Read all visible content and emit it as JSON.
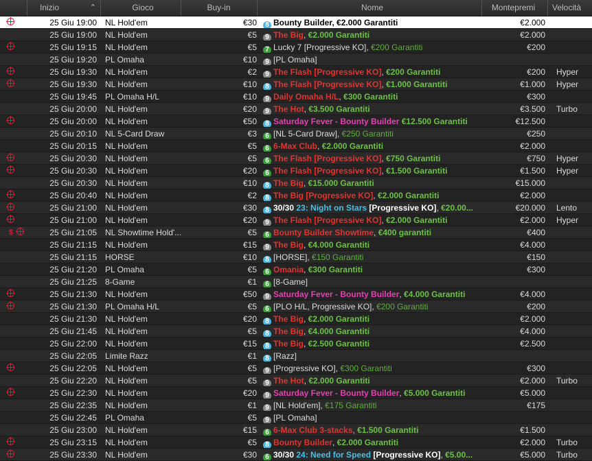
{
  "headers": {
    "start": "Inizio",
    "game": "Gioco",
    "buyin": "Buy-in",
    "name": "Nome",
    "prize": "Montepremi",
    "speed": "Velocità",
    "sort_icon": "sort-up-arrow-icon"
  },
  "colors": {
    "target_icon": "#e01b2f",
    "red_title": "#e2342f",
    "green_guarantee": "#6cc244",
    "pink_title": "#e640b4",
    "cyan_title": "#49c0e6",
    "badge_cyan": "#4fb6e0",
    "badge_gray": "#8a8a8a",
    "badge_green": "#3d9e3d"
  },
  "rows": [
    {
      "icon": "target",
      "start": "25 Giu  19:00",
      "game": "NL Hold'em",
      "buyin": "€30",
      "badge": "8",
      "badge_color": "cyan",
      "parts": [
        {
          "t": "Bounty Builder",
          "c": "white-b"
        },
        {
          "t": ", ",
          "c": "white-b"
        },
        {
          "t": "€2.000 Garantiti",
          "c": "white-b"
        }
      ],
      "prize": "€2.000",
      "speed": "",
      "selected": true
    },
    {
      "icon": "",
      "start": "25 Giu  19:00",
      "game": "NL Hold'em",
      "buyin": "€5",
      "badge": "9",
      "badge_color": "gray",
      "parts": [
        {
          "t": "The Big",
          "c": "red"
        },
        {
          "t": ", ",
          "c": "plain"
        },
        {
          "t": "€2.000 Garantiti",
          "c": "green"
        }
      ],
      "prize": "€2.000",
      "speed": ""
    },
    {
      "icon": "target",
      "start": "25 Giu  19:15",
      "game": "NL Hold'em",
      "buyin": "€5",
      "badge": "7",
      "badge_color": "green",
      "parts": [
        {
          "t": "Lucky 7 [Progressive KO]",
          "c": "plain"
        },
        {
          "t": ", ",
          "c": "plain"
        },
        {
          "t": "€200 Garantiti",
          "c": "dkgreen"
        }
      ],
      "prize": "€200",
      "speed": ""
    },
    {
      "icon": "",
      "start": "25 Giu  19:20",
      "game": "PL Omaha",
      "buyin": "€10",
      "badge": "9",
      "badge_color": "gray",
      "parts": [
        {
          "t": "[PL Omaha]",
          "c": "plain"
        }
      ],
      "prize": "",
      "speed": ""
    },
    {
      "icon": "target",
      "start": "25 Giu  19:30",
      "game": "NL Hold'em",
      "buyin": "€2",
      "badge": "9",
      "badge_color": "gray",
      "parts": [
        {
          "t": "The Flash [Progressive KO]",
          "c": "red"
        },
        {
          "t": ", ",
          "c": "plain"
        },
        {
          "t": "€200 Garantiti",
          "c": "green"
        }
      ],
      "prize": "€200",
      "speed": "Hyper"
    },
    {
      "icon": "target",
      "start": "25 Giu  19:30",
      "game": "NL Hold'em",
      "buyin": "€10",
      "badge": "8",
      "badge_color": "cyan",
      "parts": [
        {
          "t": "The Flash [Progressive KO]",
          "c": "red"
        },
        {
          "t": ", ",
          "c": "plain"
        },
        {
          "t": "€1.000 Garantiti",
          "c": "green"
        }
      ],
      "prize": "€1.000",
      "speed": "Hyper"
    },
    {
      "icon": "",
      "start": "25 Giu  19:45",
      "game": "PL Omaha H/L",
      "buyin": "€10",
      "badge": "9",
      "badge_color": "gray",
      "parts": [
        {
          "t": "Daily Omaha H/L",
          "c": "red"
        },
        {
          "t": ", ",
          "c": "plain"
        },
        {
          "t": "€300 Garantiti",
          "c": "green"
        }
      ],
      "prize": "€300",
      "speed": ""
    },
    {
      "icon": "",
      "start": "25 Giu  20:00",
      "game": "NL Hold'em",
      "buyin": "€20",
      "badge": "9",
      "badge_color": "gray",
      "parts": [
        {
          "t": "The Hot",
          "c": "red"
        },
        {
          "t": ", ",
          "c": "plain"
        },
        {
          "t": "€3.500 Garantiti",
          "c": "green"
        }
      ],
      "prize": "€3.500",
      "speed": "Turbo"
    },
    {
      "icon": "target",
      "start": "25 Giu  20:00",
      "game": "NL Hold'em",
      "buyin": "€50",
      "badge": "8",
      "badge_color": "cyan",
      "parts": [
        {
          "t": "Saturday Fever - Bounty Builder",
          "c": "pink"
        },
        {
          "t": " ",
          "c": "plain"
        },
        {
          "t": "€12.500 Garantiti",
          "c": "green"
        }
      ],
      "prize": "€12.500",
      "speed": ""
    },
    {
      "icon": "",
      "start": "25 Giu  20:10",
      "game": "NL 5-Card Draw",
      "buyin": "€3",
      "badge": "6",
      "badge_color": "green",
      "parts": [
        {
          "t": "[NL 5-Card Draw]",
          "c": "plain"
        },
        {
          "t": ", ",
          "c": "plain"
        },
        {
          "t": "€250 Garantiti",
          "c": "dkgreen"
        }
      ],
      "prize": "€250",
      "speed": ""
    },
    {
      "icon": "",
      "start": "25 Giu  20:15",
      "game": "NL Hold'em",
      "buyin": "€5",
      "badge": "6",
      "badge_color": "green",
      "parts": [
        {
          "t": "6-Max Club",
          "c": "red"
        },
        {
          "t": ", ",
          "c": "plain"
        },
        {
          "t": "€2.000 Garantiti",
          "c": "green"
        }
      ],
      "prize": "€2.000",
      "speed": ""
    },
    {
      "icon": "target",
      "start": "25 Giu  20:30",
      "game": "NL Hold'em",
      "buyin": "€5",
      "badge": "6",
      "badge_color": "green",
      "parts": [
        {
          "t": "The Flash [Progressive KO]",
          "c": "red"
        },
        {
          "t": ", ",
          "c": "plain"
        },
        {
          "t": "€750 Garantiti",
          "c": "green"
        }
      ],
      "prize": "€750",
      "speed": "Hyper"
    },
    {
      "icon": "target",
      "start": "25 Giu  20:30",
      "game": "NL Hold'em",
      "buyin": "€20",
      "badge": "6",
      "badge_color": "green",
      "parts": [
        {
          "t": "The Flash [Progressive KO]",
          "c": "red"
        },
        {
          "t": ", ",
          "c": "plain"
        },
        {
          "t": "€1.500 Garantiti",
          "c": "green"
        }
      ],
      "prize": "€1.500",
      "speed": "Hyper"
    },
    {
      "icon": "",
      "start": "25 Giu  20:30",
      "game": "NL Hold'em",
      "buyin": "€10",
      "badge": "8",
      "badge_color": "cyan",
      "parts": [
        {
          "t": "The Big",
          "c": "red"
        },
        {
          "t": ", ",
          "c": "plain"
        },
        {
          "t": "€15.000 Garantiti",
          "c": "green"
        }
      ],
      "prize": "€15.000",
      "speed": ""
    },
    {
      "icon": "target",
      "start": "25 Giu  20:40",
      "game": "NL Hold'em",
      "buyin": "€2",
      "badge": "8",
      "badge_color": "cyan",
      "parts": [
        {
          "t": "The Big [Progressive KO]",
          "c": "red"
        },
        {
          "t": ", ",
          "c": "plain"
        },
        {
          "t": "€2.000 Garantiti",
          "c": "green"
        }
      ],
      "prize": "€2.000",
      "speed": ""
    },
    {
      "icon": "target",
      "start": "25 Giu  21:00",
      "game": "NL Hold'em",
      "buyin": "€30",
      "badge": "8",
      "badge_color": "cyan",
      "parts": [
        {
          "t": "30/30 ",
          "c": "white-b"
        },
        {
          "t": "23: Night on Stars",
          "c": "cyan"
        },
        {
          "t": " [Progressive KO]",
          "c": "white-b"
        },
        {
          "t": ", ",
          "c": "plain"
        },
        {
          "t": "€20.00...",
          "c": "green"
        }
      ],
      "prize": "€20.000",
      "speed": "Lento"
    },
    {
      "icon": "target",
      "start": "25 Giu  21:00",
      "game": "NL Hold'em",
      "buyin": "€20",
      "badge": "9",
      "badge_color": "gray",
      "parts": [
        {
          "t": "The Flash [Progressive KO]",
          "c": "red"
        },
        {
          "t": ", ",
          "c": "plain"
        },
        {
          "t": "€2.000 Garantiti",
          "c": "green"
        }
      ],
      "prize": "€2.000",
      "speed": "Hyper"
    },
    {
      "icon": "dollar-target",
      "start": "25 Giu  21:05",
      "game": "NL Showtime Hold'...",
      "buyin": "€5",
      "badge": "6",
      "badge_color": "green",
      "parts": [
        {
          "t": "Bounty Builder Showtime",
          "c": "red"
        },
        {
          "t": ", ",
          "c": "plain"
        },
        {
          "t": "€400 garantiti",
          "c": "green"
        }
      ],
      "prize": "€400",
      "speed": ""
    },
    {
      "icon": "",
      "start": "25 Giu  21:15",
      "game": "NL Hold'em",
      "buyin": "€15",
      "badge": "9",
      "badge_color": "gray",
      "parts": [
        {
          "t": "The Big",
          "c": "red"
        },
        {
          "t": ", ",
          "c": "plain"
        },
        {
          "t": "€4.000 Garantiti",
          "c": "green"
        }
      ],
      "prize": "€4.000",
      "speed": ""
    },
    {
      "icon": "",
      "start": "25 Giu  21:15",
      "game": "HORSE",
      "buyin": "€10",
      "badge": "8",
      "badge_color": "cyan",
      "parts": [
        {
          "t": "[HORSE]",
          "c": "plain"
        },
        {
          "t": ", ",
          "c": "plain"
        },
        {
          "t": "€150 Garantiti",
          "c": "dkgreen"
        }
      ],
      "prize": "€150",
      "speed": ""
    },
    {
      "icon": "",
      "start": "25 Giu  21:20",
      "game": "PL Omaha",
      "buyin": "€5",
      "badge": "6",
      "badge_color": "green",
      "parts": [
        {
          "t": "Omania",
          "c": "red"
        },
        {
          "t": ", ",
          "c": "plain"
        },
        {
          "t": "€300 Garantiti",
          "c": "green"
        }
      ],
      "prize": "€300",
      "speed": ""
    },
    {
      "icon": "",
      "start": "25 Giu  21:25",
      "game": "8-Game",
      "buyin": "€1",
      "badge": "6",
      "badge_color": "green",
      "parts": [
        {
          "t": "[8-Game]",
          "c": "plain"
        }
      ],
      "prize": "",
      "speed": ""
    },
    {
      "icon": "target",
      "start": "25 Giu  21:30",
      "game": "NL Hold'em",
      "buyin": "€50",
      "badge": "9",
      "badge_color": "gray",
      "parts": [
        {
          "t": "Saturday Fever - Bounty Builder",
          "c": "pink"
        },
        {
          "t": ", ",
          "c": "plain"
        },
        {
          "t": "€4.000 Garantiti",
          "c": "green"
        }
      ],
      "prize": "€4.000",
      "speed": ""
    },
    {
      "icon": "target",
      "start": "25 Giu  21:30",
      "game": "PL Omaha H/L",
      "buyin": "€5",
      "badge": "6",
      "badge_color": "green",
      "parts": [
        {
          "t": "[PLO H/L, Progressive KO]",
          "c": "plain"
        },
        {
          "t": ", ",
          "c": "plain"
        },
        {
          "t": "€200 Garantiti",
          "c": "dkgreen"
        }
      ],
      "prize": "€200",
      "speed": ""
    },
    {
      "icon": "",
      "start": "25 Giu  21:30",
      "game": "NL Hold'em",
      "buyin": "€20",
      "badge": "8",
      "badge_color": "cyan",
      "parts": [
        {
          "t": "The Big",
          "c": "red"
        },
        {
          "t": ", ",
          "c": "plain"
        },
        {
          "t": "€2.000 Garantiti",
          "c": "green"
        }
      ],
      "prize": "€2.000",
      "speed": ""
    },
    {
      "icon": "",
      "start": "25 Giu  21:45",
      "game": "NL Hold'em",
      "buyin": "€5",
      "badge": "8",
      "badge_color": "cyan",
      "parts": [
        {
          "t": "The Big",
          "c": "red"
        },
        {
          "t": ", ",
          "c": "plain"
        },
        {
          "t": "€4.000 Garantiti",
          "c": "green"
        }
      ],
      "prize": "€4.000",
      "speed": ""
    },
    {
      "icon": "",
      "start": "25 Giu  22:00",
      "game": "NL Hold'em",
      "buyin": "€15",
      "badge": "8",
      "badge_color": "cyan",
      "parts": [
        {
          "t": "The Big",
          "c": "red"
        },
        {
          "t": ", ",
          "c": "plain"
        },
        {
          "t": "€2.500 Garantiti",
          "c": "green"
        }
      ],
      "prize": "€2.500",
      "speed": ""
    },
    {
      "icon": "",
      "start": "25 Giu  22:05",
      "game": "Limite Razz",
      "buyin": "€1",
      "badge": "8",
      "badge_color": "cyan",
      "parts": [
        {
          "t": "[Razz]",
          "c": "plain"
        }
      ],
      "prize": "",
      "speed": ""
    },
    {
      "icon": "target",
      "start": "25 Giu  22:05",
      "game": "NL Hold'em",
      "buyin": "€5",
      "badge": "9",
      "badge_color": "gray",
      "parts": [
        {
          "t": "[Progressive KO]",
          "c": "plain"
        },
        {
          "t": ", ",
          "c": "plain"
        },
        {
          "t": "€300 Garantiti",
          "c": "dkgreen"
        }
      ],
      "prize": "€300",
      "speed": ""
    },
    {
      "icon": "",
      "start": "25 Giu  22:20",
      "game": "NL Hold'em",
      "buyin": "€5",
      "badge": "9",
      "badge_color": "gray",
      "parts": [
        {
          "t": "The Hot",
          "c": "red"
        },
        {
          "t": ", ",
          "c": "plain"
        },
        {
          "t": "€2.000 Garantiti",
          "c": "green"
        }
      ],
      "prize": "€2.000",
      "speed": "Turbo"
    },
    {
      "icon": "target",
      "start": "25 Giu  22:30",
      "game": "NL Hold'em",
      "buyin": "€20",
      "badge": "9",
      "badge_color": "gray",
      "parts": [
        {
          "t": "Saturday Fever - Bounty Builder",
          "c": "pink"
        },
        {
          "t": ", ",
          "c": "plain"
        },
        {
          "t": "€5.000 Garantiti",
          "c": "green"
        }
      ],
      "prize": "€5.000",
      "speed": ""
    },
    {
      "icon": "",
      "start": "25 Giu  22:35",
      "game": "NL Hold'em",
      "buyin": "€1",
      "badge": "9",
      "badge_color": "gray",
      "parts": [
        {
          "t": "[NL Hold'em]",
          "c": "plain"
        },
        {
          "t": ", ",
          "c": "plain"
        },
        {
          "t": "€175 Garantiti",
          "c": "dkgreen"
        }
      ],
      "prize": "€175",
      "speed": ""
    },
    {
      "icon": "",
      "start": "25 Giu  22:45",
      "game": "PL Omaha",
      "buyin": "€5",
      "badge": "9",
      "badge_color": "gray",
      "parts": [
        {
          "t": "[PL Omaha]",
          "c": "plain"
        }
      ],
      "prize": "",
      "speed": ""
    },
    {
      "icon": "",
      "start": "25 Giu  23:00",
      "game": "NL Hold'em",
      "buyin": "€15",
      "badge": "6",
      "badge_color": "green",
      "parts": [
        {
          "t": "6-Max Club 3-stacks",
          "c": "red"
        },
        {
          "t": ", ",
          "c": "plain"
        },
        {
          "t": "€1.500 Garantiti",
          "c": "green"
        }
      ],
      "prize": "€1.500",
      "speed": ""
    },
    {
      "icon": "target",
      "start": "25 Giu  23:15",
      "game": "NL Hold'em",
      "buyin": "€5",
      "badge": "8",
      "badge_color": "cyan",
      "parts": [
        {
          "t": "Bounty Builder",
          "c": "red"
        },
        {
          "t": ", ",
          "c": "plain"
        },
        {
          "t": "€2.000 Garantiti",
          "c": "green"
        }
      ],
      "prize": "€2.000",
      "speed": "Turbo"
    },
    {
      "icon": "target",
      "start": "25 Giu  23:30",
      "game": "NL Hold'em",
      "buyin": "€30",
      "badge": "6",
      "badge_color": "green",
      "parts": [
        {
          "t": "30/30 ",
          "c": "white-b"
        },
        {
          "t": "24: Need for Speed",
          "c": "cyan"
        },
        {
          "t": " [Progressive KO]",
          "c": "white-b"
        },
        {
          "t": ", ",
          "c": "plain"
        },
        {
          "t": "€5.00...",
          "c": "green"
        }
      ],
      "prize": "€5.000",
      "speed": "Turbo"
    }
  ]
}
